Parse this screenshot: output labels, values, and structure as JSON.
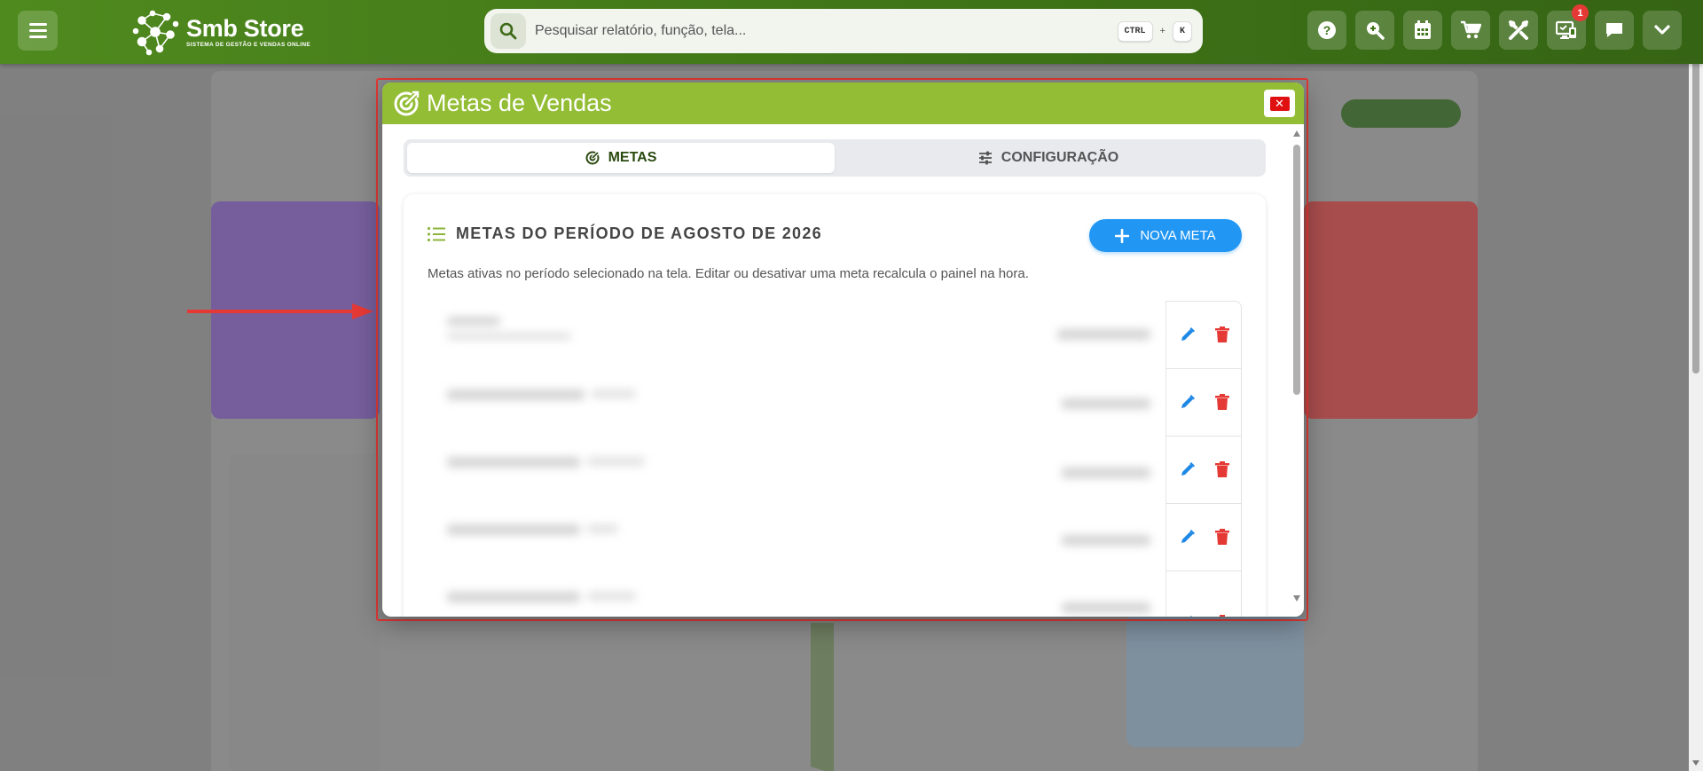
{
  "app": {
    "name": "Smb Store",
    "tagline": "SISTEMA DE GESTÃO E VENDAS ONLINE"
  },
  "search": {
    "placeholder": "Pesquisar relatório, função, tela...",
    "shortcut_ctrl": "CTRL",
    "shortcut_plus": "+",
    "shortcut_key": "K"
  },
  "toolbar": {
    "buttons": [
      {
        "icon": "help-icon"
      },
      {
        "icon": "zoom-search-icon"
      },
      {
        "icon": "calendar-icon"
      },
      {
        "icon": "cart-icon"
      },
      {
        "icon": "tools-icon"
      },
      {
        "icon": "monitor-icon",
        "badge": "1"
      },
      {
        "icon": "chat-icon"
      },
      {
        "icon": "chevron-down-icon"
      }
    ]
  },
  "modal": {
    "title": "Metas de Vendas",
    "close_label": "✕",
    "tabs": [
      {
        "label": "METAS",
        "icon": "target-icon",
        "active": true
      },
      {
        "label": "CONFIGURAÇÃO",
        "icon": "sliders-icon",
        "active": false
      }
    ],
    "panel": {
      "title": "METAS DO PERÍODO DE AGOSTO DE 2026",
      "new_button": "NOVA META",
      "description": "Metas ativas no período selecionado na tela. Editar ou desativar uma meta recalcula o painel na hora."
    }
  },
  "colors": {
    "topbar": "#3f7417",
    "modal_header": "#93bd35",
    "primary_button": "#2196f3",
    "edit_icon": "#1e88e5",
    "delete_icon": "#e53935",
    "annotation": "#e53935"
  }
}
